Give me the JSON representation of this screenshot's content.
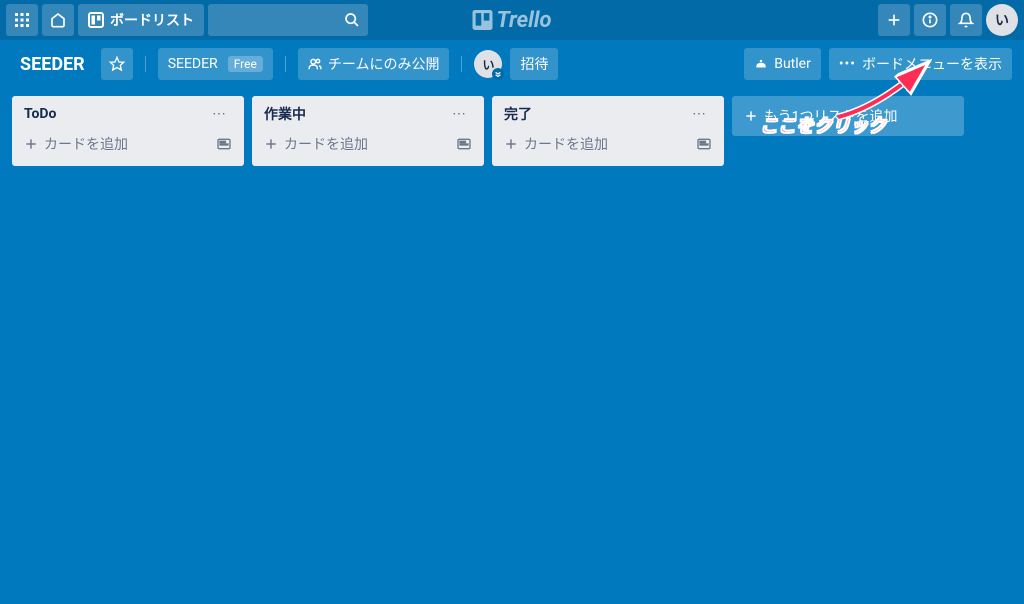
{
  "header": {
    "boards_button": "ボードリスト",
    "logo_text": "Trello",
    "avatar_initial": "い"
  },
  "board_header": {
    "title": "SEEDER",
    "team_name": "SEEDER",
    "team_plan": "Free",
    "visibility": "チームにのみ公開",
    "member_initial": "い",
    "invite": "招待",
    "butler": "Butler",
    "show_menu": "ボードメニューを表示"
  },
  "lists": [
    {
      "title": "ToDo",
      "add_card": "カードを追加"
    },
    {
      "title": "作業中",
      "add_card": "カードを追加"
    },
    {
      "title": "完了",
      "add_card": "カードを追加"
    }
  ],
  "add_list": "もう1つリストを追加",
  "annotation": "ここをクリック"
}
